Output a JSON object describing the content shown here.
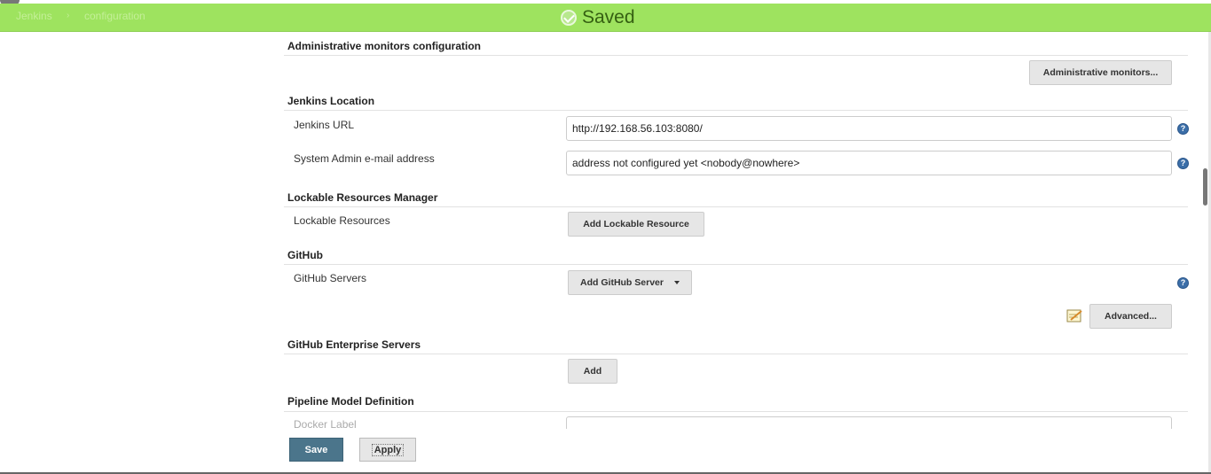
{
  "breadcrumb": {
    "item1": "Jenkins",
    "separator": "›",
    "item2": "configuration"
  },
  "notification": {
    "text": "Saved",
    "color": "#9ee35f"
  },
  "sections": {
    "admin_monitors": {
      "title": "Administrative monitors configuration",
      "button": "Administrative monitors..."
    },
    "jenkins_location": {
      "title": "Jenkins Location",
      "url_label": "Jenkins URL",
      "url_value": "http://192.168.56.103:8080/",
      "email_label": "System Admin e-mail address",
      "email_value": "address not configured yet <nobody@nowhere>"
    },
    "lockable": {
      "title": "Lockable Resources Manager",
      "label": "Lockable Resources",
      "button": "Add Lockable Resource"
    },
    "github": {
      "title": "GitHub",
      "servers_label": "GitHub Servers",
      "add_button": "Add GitHub Server",
      "advanced_button": "Advanced..."
    },
    "github_enterprise": {
      "title": "GitHub Enterprise Servers",
      "add_button": "Add"
    },
    "pipeline": {
      "title": "Pipeline Model Definition",
      "docker_label": "Docker Label"
    }
  },
  "footer": {
    "save": "Save",
    "apply": "Apply",
    "save_color": "#4b758b"
  },
  "icons": {
    "help": "help-icon",
    "notepad": "notepad-icon",
    "check": "check-circle-icon"
  }
}
